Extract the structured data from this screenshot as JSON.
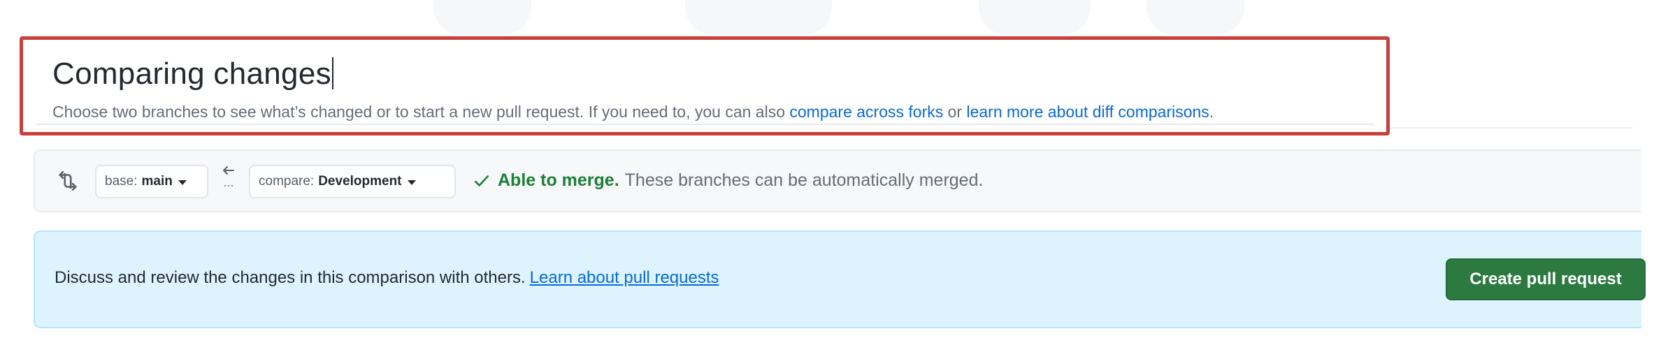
{
  "header": {
    "title": "Comparing changes",
    "subtitle_prefix": "Choose two branches to see what’s changed or to start a new pull request. If you need to, you can also ",
    "link_compare_forks": "compare across forks",
    "subtitle_or": " or ",
    "link_learn_diff": "learn more about diff comparisons",
    "subtitle_suffix": "."
  },
  "compare_bar": {
    "sync_icon": "git-compare-icon",
    "base_label": "base:",
    "base_branch": "main",
    "arrow_icon": "arrow-left-icon",
    "compare_label": "compare:",
    "compare_branch": "Development",
    "check_icon": "check-icon",
    "merge_status": "Able to merge.",
    "merge_description": "These branches can be automatically merged."
  },
  "banner": {
    "text": "Discuss and review the changes in this comparison with others.",
    "link": "Learn about pull requests",
    "button": "Create pull request"
  },
  "colors": {
    "highlight_border": "#c8403b",
    "success_green": "#1a7f37",
    "primary_button": "#2c7a3f",
    "link_blue": "#0969da",
    "banner_bg": "#ddf4ff"
  }
}
